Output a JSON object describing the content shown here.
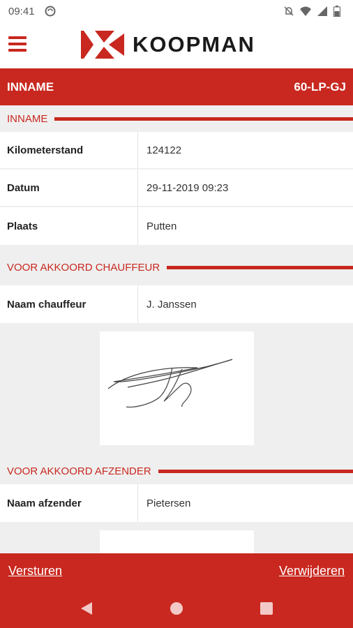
{
  "status_bar": {
    "time": "09:41"
  },
  "header": {
    "logo_text": "KOOPMAN"
  },
  "title_bar": {
    "title": "INNAME",
    "plate": "60-LP-GJ"
  },
  "sections": [
    {
      "title": "INNAME",
      "rows": [
        {
          "label": "Kilometerstand",
          "value": "124122"
        },
        {
          "label": "Datum",
          "value": "29-11-2019 09:23"
        },
        {
          "label": "Plaats",
          "value": "Putten"
        }
      ]
    },
    {
      "title": "VOOR AKKOORD CHAUFFEUR",
      "rows": [
        {
          "label": "Naam chauffeur",
          "value": "J. Janssen"
        }
      ]
    },
    {
      "title": "VOOR AKKOORD AFZENDER",
      "rows": [
        {
          "label": "Naam afzender",
          "value": "Pietersen"
        }
      ]
    }
  ],
  "actions": {
    "send": "Versturen",
    "delete": "Verwijderen"
  },
  "colors": {
    "brand": "#c8281f",
    "background": "#efefef"
  },
  "icons": [
    "menu-icon",
    "back-icon",
    "home-icon",
    "recents-icon",
    "wifi-icon",
    "signal-icon",
    "battery-icon",
    "do-not-disturb-icon",
    "sync-icon"
  ]
}
